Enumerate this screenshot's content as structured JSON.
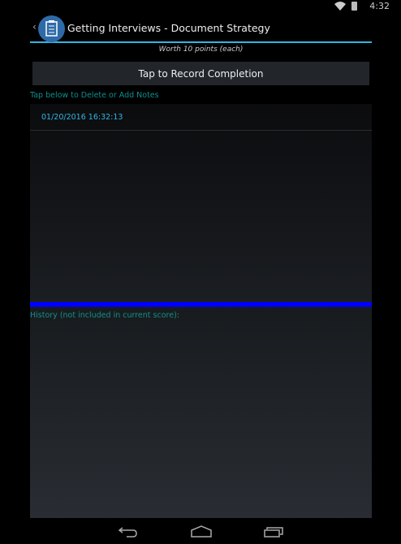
{
  "status": {
    "time": "4:32"
  },
  "actionbar": {
    "title": "Getting Interviews - Document Strategy"
  },
  "worth": "Worth 10 points (each)",
  "record_button": "Tap to Record Completion",
  "tap_label": "Tap below to Delete or Add Notes",
  "entries": [
    "01/20/2016 16:32:13"
  ],
  "history_label": "History (not included in current score):",
  "colors": {
    "accent": "#33b5e5",
    "divider": "#0000ff",
    "label": "#0f8f8f"
  }
}
